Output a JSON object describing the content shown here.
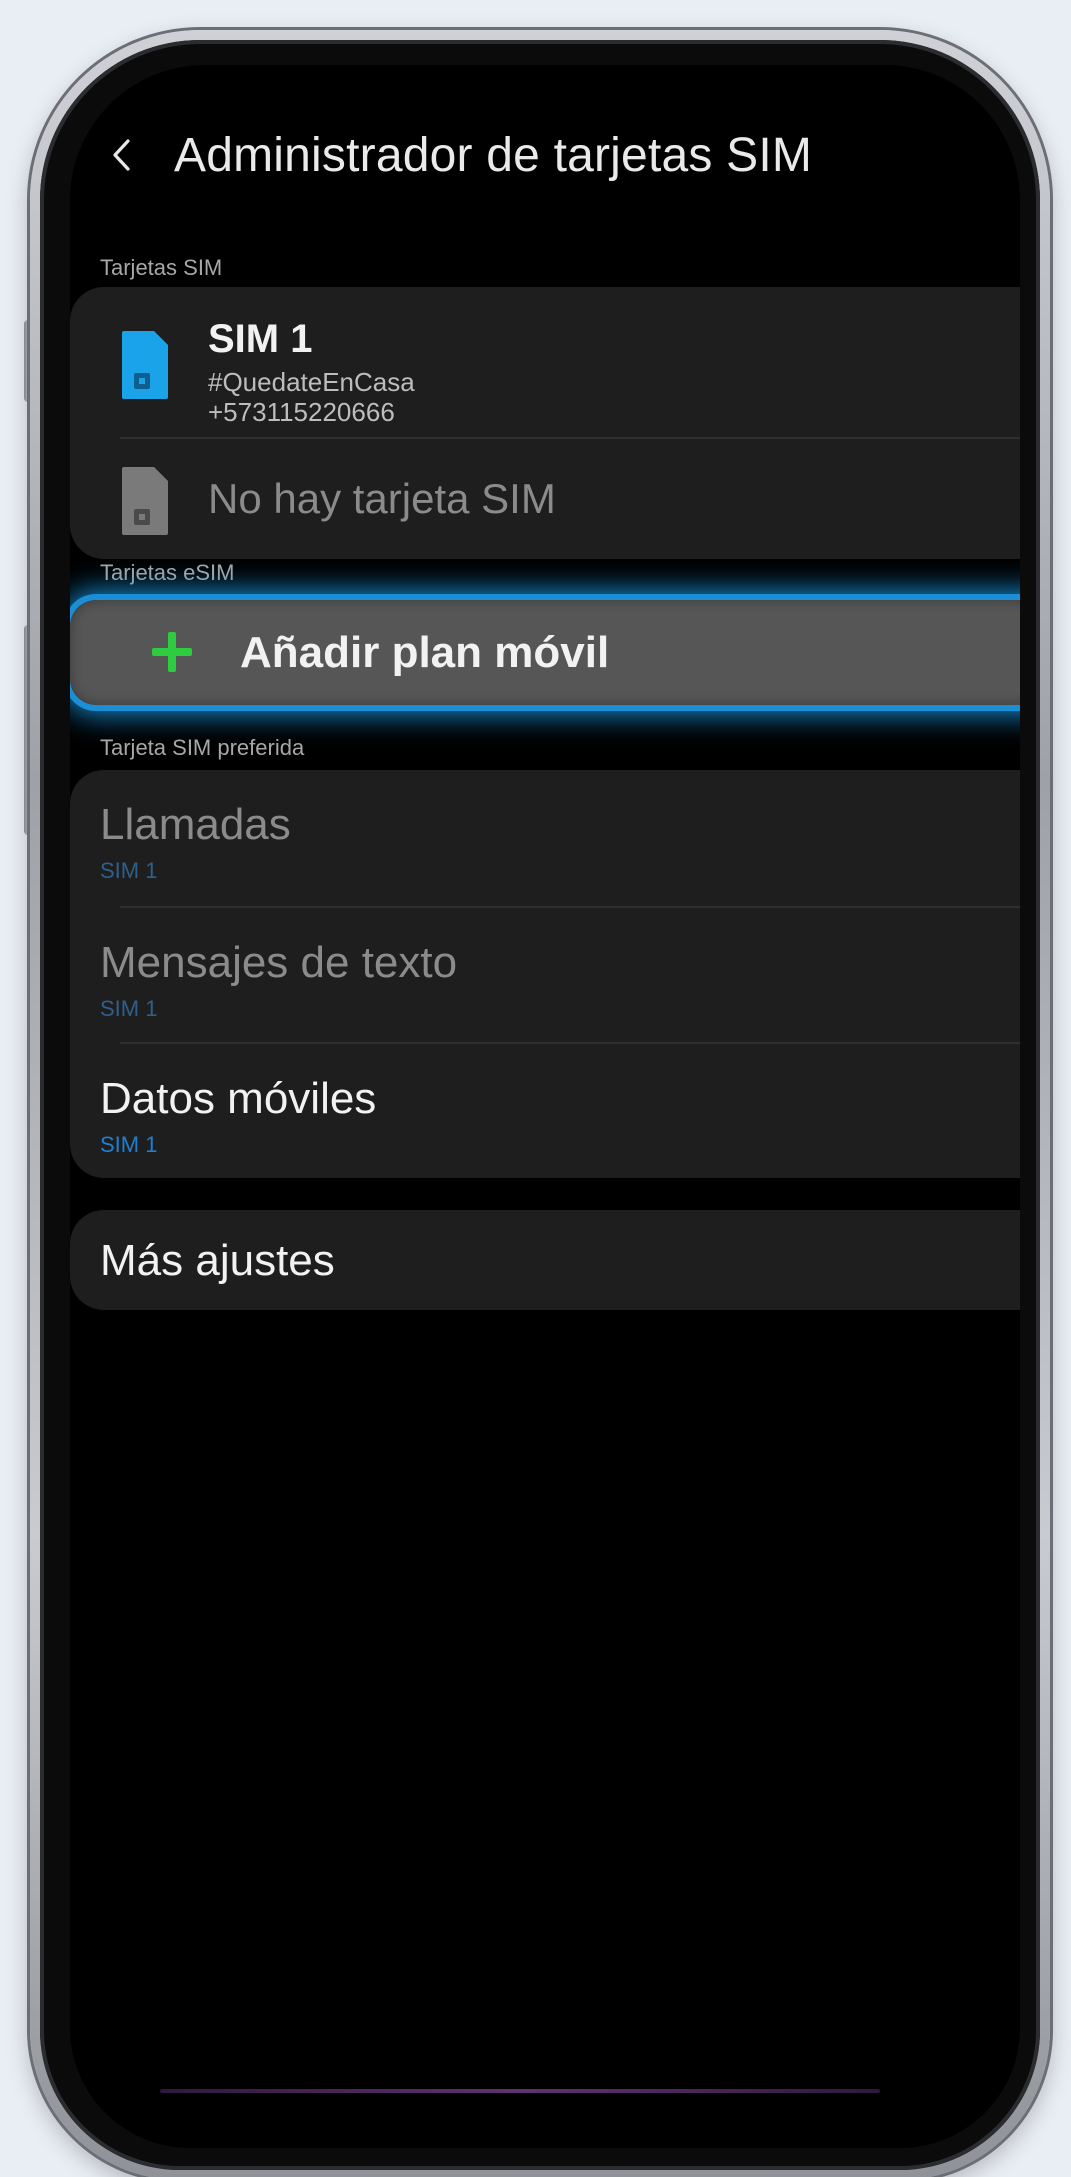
{
  "header": {
    "title": "Administrador de tarjetas SIM"
  },
  "sections": {
    "sim_cards_label": "Tarjetas SIM",
    "esim_label": "Tarjetas eSIM",
    "preferred_label": "Tarjeta SIM preferida"
  },
  "sim_cards": {
    "sim1": {
      "title": "SIM 1",
      "carrier": "#QuedateEnCasa",
      "number": "+573115220666"
    },
    "empty_slot": {
      "label": "No hay tarjeta SIM"
    }
  },
  "esim": {
    "add_plan_label": "Añadir plan móvil"
  },
  "preferred": {
    "calls": {
      "title": "Llamadas",
      "value": "SIM 1"
    },
    "texts": {
      "title": "Mensajes de texto",
      "value": "SIM 1"
    },
    "data": {
      "title": "Datos móviles",
      "value": "SIM 1"
    }
  },
  "more": {
    "label": "Más ajustes"
  },
  "colors": {
    "accent_blue": "#1e7fd0",
    "sim_icon_blue": "#1aa3e8",
    "add_icon_green": "#2ecc40",
    "highlight_glow": "#1a8fd6"
  }
}
